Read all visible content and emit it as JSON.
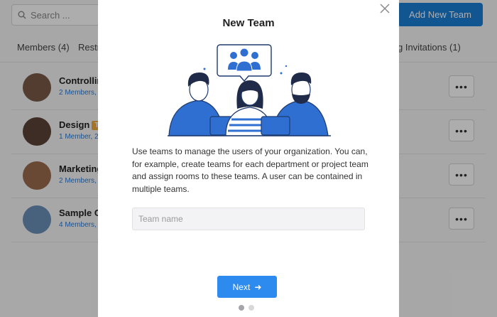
{
  "background": {
    "search_placeholder": "Search ...",
    "add_team_label": "Add New Team",
    "tabs": [
      "Members (4)",
      "Restr",
      "g Invitations (1)"
    ],
    "teams": [
      {
        "name": "Controllin",
        "sub": "2 Members, ",
        "badge": ""
      },
      {
        "name": "Design",
        "sub": "1 Member, 2",
        "badge": "Te"
      },
      {
        "name": "Marketing",
        "sub": "2 Members, ",
        "badge": ""
      },
      {
        "name": "Sample Co",
        "sub": "4 Members, ",
        "badge": ""
      }
    ],
    "more_label": "•••"
  },
  "modal": {
    "title": "New Team",
    "description": "Use teams to manage the users of your organization. You can, for example, create teams for each department or project team and assign rooms to these teams. A user can be contained in multiple teams.",
    "input_placeholder": "Team name",
    "input_value": "",
    "next_label": "Next",
    "next_arrow": "➜",
    "step_current": 1,
    "step_total": 2
  },
  "colors": {
    "accent": "#2d8bf0",
    "illustration_blue": "#2f6fd1"
  },
  "icons": {
    "search": "search-icon",
    "close": "close-icon",
    "more": "more-icon"
  }
}
